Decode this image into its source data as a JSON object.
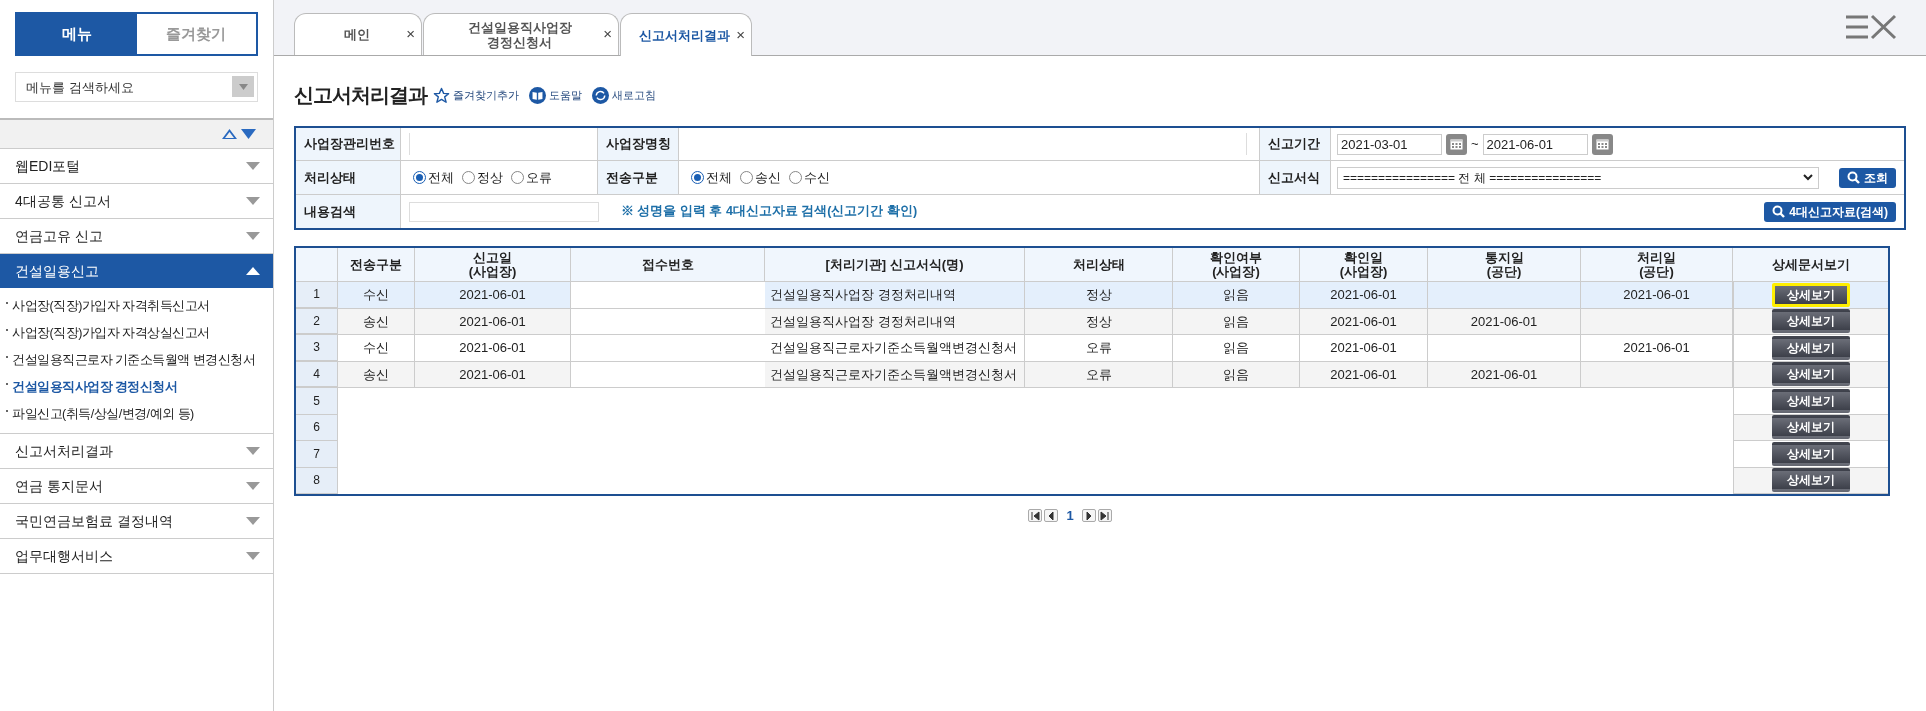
{
  "sidebar": {
    "tabs": [
      {
        "label": "메뉴",
        "selected": true
      },
      {
        "label": "즐겨찾기",
        "selected": false
      }
    ],
    "search": {
      "placeholder": "메뉴를 검색하세요"
    },
    "items": [
      {
        "label": "웹EDI포털",
        "expanded": false
      },
      {
        "label": "4대공통 신고서",
        "expanded": false
      },
      {
        "label": "연금고유 신고",
        "expanded": false
      },
      {
        "label": "건설일용신고",
        "expanded": true,
        "children": [
          {
            "label": "사업장(직장)가입자 자격취득신고서",
            "selected": false
          },
          {
            "label": "사업장(직장)가입자 자격상실신고서",
            "selected": false
          },
          {
            "label": "건설일용직근로자 기준소득월액 변경신청서",
            "selected": false
          },
          {
            "label": "건설일용직사업장 경정신청서",
            "selected": true
          },
          {
            "label": "파일신고(취득/상실/변경/예외 등)",
            "selected": false
          }
        ]
      },
      {
        "label": "신고서처리결과",
        "expanded": false
      },
      {
        "label": "연금 통지문서",
        "expanded": false
      },
      {
        "label": "국민연금보험료 결정내역",
        "expanded": false
      },
      {
        "label": "업무대행서비스",
        "expanded": false
      }
    ]
  },
  "tabs": [
    {
      "label": "메인",
      "selected": false,
      "close": "×"
    },
    {
      "label": "건설일용직사업장 경정신청서",
      "selected": false,
      "close": "×"
    },
    {
      "label": "신고서처리결과",
      "selected": true,
      "close": "×"
    }
  ],
  "page": {
    "title": "신고서처리결과",
    "actions": [
      "즐겨찾기추가",
      "도움말",
      "새로고침"
    ]
  },
  "form": {
    "biz_number_label": "사업장관리번호",
    "biz_name_label": "사업장명칭",
    "period_label": "신고기간",
    "period_from": "2021-03-01",
    "period_sep": "~",
    "period_to": "2021-06-01",
    "status_label": "처리상태",
    "status_options": [
      {
        "label": "전체",
        "selected": true
      },
      {
        "label": "정상",
        "selected": false
      },
      {
        "label": "오류",
        "selected": false
      }
    ],
    "transfer_label": "전송구분",
    "transfer_options": [
      {
        "label": "전체",
        "selected": true
      },
      {
        "label": "송신",
        "selected": false
      },
      {
        "label": "수신",
        "selected": false
      }
    ],
    "format_label": "신고서식",
    "format_value": "================ 전 체 ================",
    "query_button": "조회",
    "content_label": "내용검색",
    "hint": "※ 성명을 입력 후 4대신고자료 검색(신고기간 확인)",
    "search_button": "4대신고자료(검색)"
  },
  "table": {
    "columns": [
      {
        "label": "전송구분"
      },
      {
        "label": "신고일",
        "sub": "(사업장)"
      },
      {
        "label": "접수번호"
      },
      {
        "label": "[처리기관] 신고서식(명)"
      },
      {
        "label": "처리상태"
      },
      {
        "label": "확인여부",
        "sub": "(사업장)"
      },
      {
        "label": "확인일",
        "sub": "(사업장)"
      },
      {
        "label": "통지일",
        "sub": "(공단)"
      },
      {
        "label": "처리일",
        "sub": "(공단)"
      },
      {
        "label": "상세문서보기"
      }
    ],
    "rows": [
      {
        "number": "1",
        "selected": true,
        "cells": [
          "수신",
          "2021-06-01",
          "",
          "건설일용직사업장 경정처리내역",
          "정상",
          "읽음",
          "2021-06-01",
          "",
          "2021-06-01"
        ],
        "button": "상세보기",
        "highlighted": true
      },
      {
        "number": "2",
        "selected": false,
        "cells": [
          "송신",
          "2021-06-01",
          "",
          "건설일용직사업장 경정처리내역",
          "정상",
          "읽음",
          "2021-06-01",
          "2021-06-01",
          ""
        ],
        "button": "상세보기",
        "highlighted": false
      },
      {
        "number": "3",
        "selected": false,
        "cells": [
          "수신",
          "2021-06-01",
          "",
          "건설일용직근로자기준소득월액변경신청서",
          "오류",
          "읽음",
          "2021-06-01",
          "",
          "2021-06-01"
        ],
        "button": "상세보기",
        "highlighted": false
      },
      {
        "number": "4",
        "selected": false,
        "cells": [
          "송신",
          "2021-06-01",
          "",
          "건설일용직근로자기준소득월액변경신청서",
          "오류",
          "읽음",
          "2021-06-01",
          "2021-06-01",
          ""
        ],
        "button": "상세보기",
        "highlighted": false
      },
      {
        "number": "5",
        "selected": false,
        "button": "상세보기",
        "highlighted": false
      },
      {
        "number": "6",
        "selected": false,
        "button": "상세보기",
        "highlighted": false
      },
      {
        "number": "7",
        "selected": false,
        "button": "상세보기",
        "highlighted": false
      },
      {
        "number": "8",
        "selected": false,
        "button": "상세보기",
        "highlighted": false
      }
    ]
  },
  "pagination": {
    "current": "1"
  }
}
